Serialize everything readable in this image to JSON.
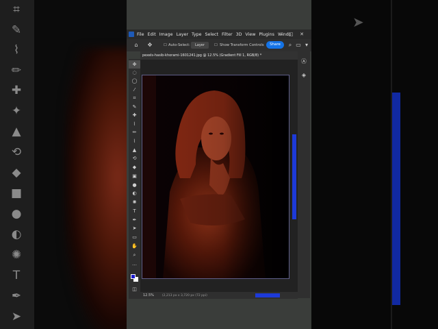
{
  "menu": {
    "items": [
      "File",
      "Edit",
      "Image",
      "Layer",
      "Type",
      "Select",
      "Filter",
      "3D",
      "View",
      "Plugins",
      "Windo"
    ]
  },
  "window_controls": {
    "minimize": "–",
    "maximize": "□",
    "close": "✕"
  },
  "options_bar": {
    "auto_select_label": "Auto-Select:",
    "layer_dropdown": "Layer",
    "show_transform_label": "Show Transform Controls",
    "share_label": "Share"
  },
  "document": {
    "tab_title": "pexels-hasib-khorami-1601241.jpg @ 12.5% (Gradient Fill 1, RGB/8) *"
  },
  "status": {
    "zoom": "12.5%",
    "dimensions": "(2,213 px x 3,720 px (72 ppi)"
  },
  "icons": {
    "move": "move-icon",
    "marquee": "marquee-icon",
    "lasso": "lasso-icon",
    "brush": "brush-icon",
    "type": "type-icon",
    "zoom": "zoom-icon"
  },
  "colors": {
    "accent_blue": "#1473e6",
    "gradient_blue": "#1d3ad8",
    "foreground_swatch": "#1c1ccc",
    "photo_red": "#8a2a14"
  }
}
